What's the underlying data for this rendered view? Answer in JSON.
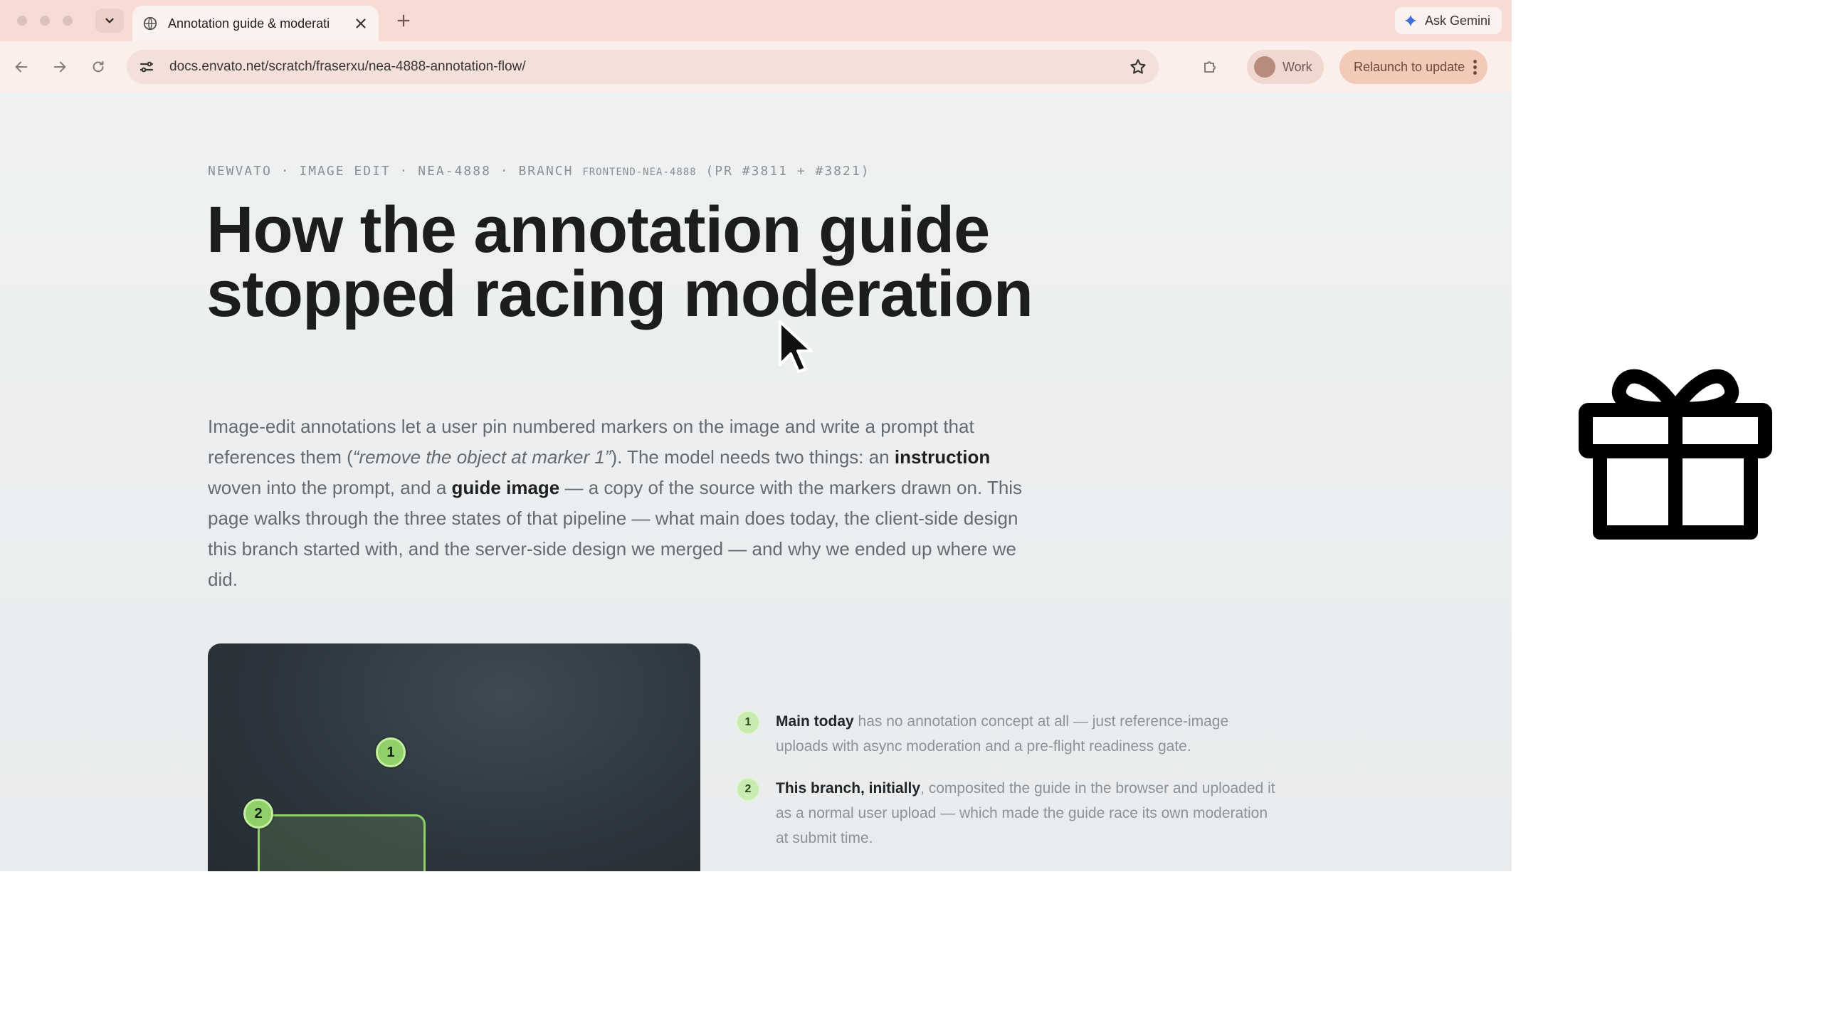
{
  "browser": {
    "tab": {
      "title": "Annotation guide & moderati",
      "close_icon": "close-icon",
      "favicon": "globe-icon"
    },
    "new_tab_icon": "plus-icon",
    "ask_gemini_label": "Ask Gemini",
    "url": "docs.envato.net/scratch/fraserxu/nea-4888-annotation-flow/",
    "profile_label": "Work",
    "relaunch_label": "Relaunch to update"
  },
  "page": {
    "eyebrow_main": "NEWVATO · IMAGE EDIT · NEA-4888 · BRANCH ",
    "eyebrow_branch": "FRONTEND-NEA-4888",
    "eyebrow_prs": " (PR #3811 + #3821)",
    "headline": "How the annotation guide stopped racing moderation",
    "intro": {
      "p1": "Image-edit annotations let a user pin numbered markers on the image and write a prompt that references them (",
      "quote": "“remove the object at marker 1”",
      "p2": "). The model needs two things: an ",
      "bold1": "instruction",
      "p3": " woven into the prompt, and a ",
      "bold2": "guide image",
      "p4": " — a copy of the source with the markers drawn on. This page walks through the three states of that pipeline — what main does today, the client-side design this branch started with, and the server-side design we merged — and why we ended up where we did."
    },
    "markers": [
      "1",
      "2"
    ],
    "notes": [
      {
        "num": "1",
        "bold": "Main today",
        "text": " has no annotation concept at all — just reference-image uploads with async moderation and a pre-flight readiness gate."
      },
      {
        "num": "2",
        "bold": "This branch, initially",
        "text": ", composited the guide in the browser and uploaded it as a normal user upload — which made the guide race its own moderation at submit time."
      }
    ]
  },
  "overlay_icon": "gift-icon",
  "colors": {
    "tab_bar": "#f6dcd4",
    "accent_green": "#8fd06a",
    "relaunch": "#f3c9b8"
  }
}
